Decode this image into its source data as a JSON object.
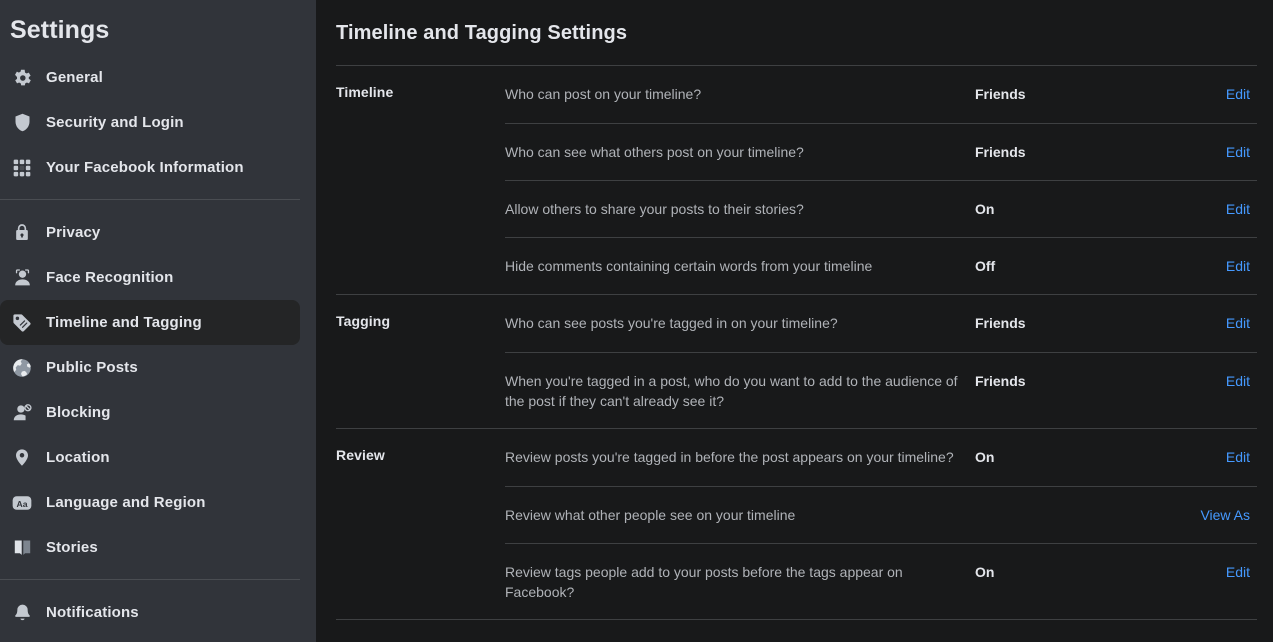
{
  "sidebar": {
    "title": "Settings",
    "groups": [
      {
        "items": [
          {
            "label": "General",
            "icon": "gear-icon",
            "active": false
          },
          {
            "label": "Security and Login",
            "icon": "shield-icon",
            "active": false
          },
          {
            "label": "Your Facebook Information",
            "icon": "grid-icon",
            "active": false
          }
        ]
      },
      {
        "items": [
          {
            "label": "Privacy",
            "icon": "lock-icon",
            "active": false
          },
          {
            "label": "Face Recognition",
            "icon": "face-recognition-icon",
            "active": false
          },
          {
            "label": "Timeline and Tagging",
            "icon": "tag-icon",
            "active": true
          },
          {
            "label": "Public Posts",
            "icon": "globe-icon",
            "active": false
          },
          {
            "label": "Blocking",
            "icon": "person-block-icon",
            "active": false
          },
          {
            "label": "Location",
            "icon": "location-pin-icon",
            "active": false
          },
          {
            "label": "Language and Region",
            "icon": "language-aa-icon",
            "active": false
          },
          {
            "label": "Stories",
            "icon": "book-icon",
            "active": false
          }
        ]
      },
      {
        "items": [
          {
            "label": "Notifications",
            "icon": "bell-icon",
            "active": false
          }
        ]
      }
    ]
  },
  "main": {
    "title": "Timeline and Tagging Settings",
    "sections": [
      {
        "label": "Timeline",
        "rows": [
          {
            "question": "Who can post on your timeline?",
            "value": "Friends",
            "action": "Edit"
          },
          {
            "question": "Who can see what others post on your timeline?",
            "value": "Friends",
            "action": "Edit"
          },
          {
            "question": "Allow others to share your posts to their stories?",
            "value": "On",
            "action": "Edit"
          },
          {
            "question": "Hide comments containing certain words from your timeline",
            "value": "Off",
            "action": "Edit"
          }
        ]
      },
      {
        "label": "Tagging",
        "rows": [
          {
            "question": "Who can see posts you're tagged in on your timeline?",
            "value": "Friends",
            "action": "Edit"
          },
          {
            "question": "When you're tagged in a post, who do you want to add to the audience of the post if they can't already see it?",
            "value": "Friends",
            "action": "Edit"
          }
        ]
      },
      {
        "label": "Review",
        "rows": [
          {
            "question": "Review posts you're tagged in before the post appears on your timeline?",
            "value": "On",
            "action": "Edit"
          },
          {
            "question": "Review what other people see on your timeline",
            "value": "",
            "action": "View As"
          },
          {
            "question": "Review tags people add to your posts before the tags appear on Facebook?",
            "value": "On",
            "action": "Edit"
          }
        ]
      }
    ]
  },
  "colors": {
    "sidebar_bg": "#31343a",
    "main_bg": "#18191a",
    "active_item_bg": "#242526",
    "link_blue": "#4599ff",
    "primary_text": "#e4e6eb",
    "secondary_text": "#b0b3b8",
    "divider": "#3e4042"
  }
}
